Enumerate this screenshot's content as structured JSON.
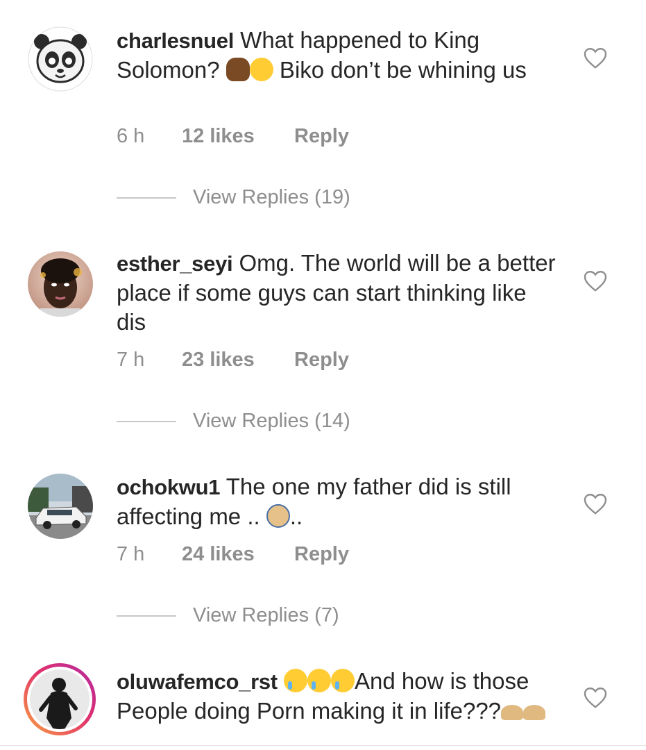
{
  "comments": [
    {
      "username": "charlesnuel",
      "text_part1": " What happened to King Solomon? ",
      "text_part2": " Biko don’t be whining us",
      "time": "6 h",
      "likes": "12 likes",
      "reply_label": "Reply",
      "view_replies": "View Replies (19)",
      "avatar_icon": "panda-avatar-icon"
    },
    {
      "username": "esther_seyi",
      "text_part1": " Omg. The world will be a better place if some guys can start thinking like dis",
      "time": "7 h",
      "likes": "23 likes",
      "reply_label": "Reply",
      "view_replies": "View Replies (14)",
      "avatar_icon": "profile-photo"
    },
    {
      "username": "ochokwu1",
      "text_part1": " The one my father did is still affecting me .. ",
      "text_part2": "..",
      "time": "7 h",
      "likes": "24 likes",
      "reply_label": "Reply",
      "view_replies": "View Replies (7)",
      "avatar_icon": "car-photo"
    },
    {
      "username": "oluwafemco_rst",
      "text_part1": " ",
      "text_part2": "And how is those People doing Porn making it in life???",
      "avatar_icon": "story-ring-avatar"
    }
  ],
  "colors": {
    "text": "#262626",
    "secondary": "#8e8e8e",
    "divider": "#c7c7c7",
    "story_ring_start": "#f9a43f",
    "story_ring_end": "#b12aa5"
  },
  "icons": {
    "like": "heart-outline-icon"
  }
}
